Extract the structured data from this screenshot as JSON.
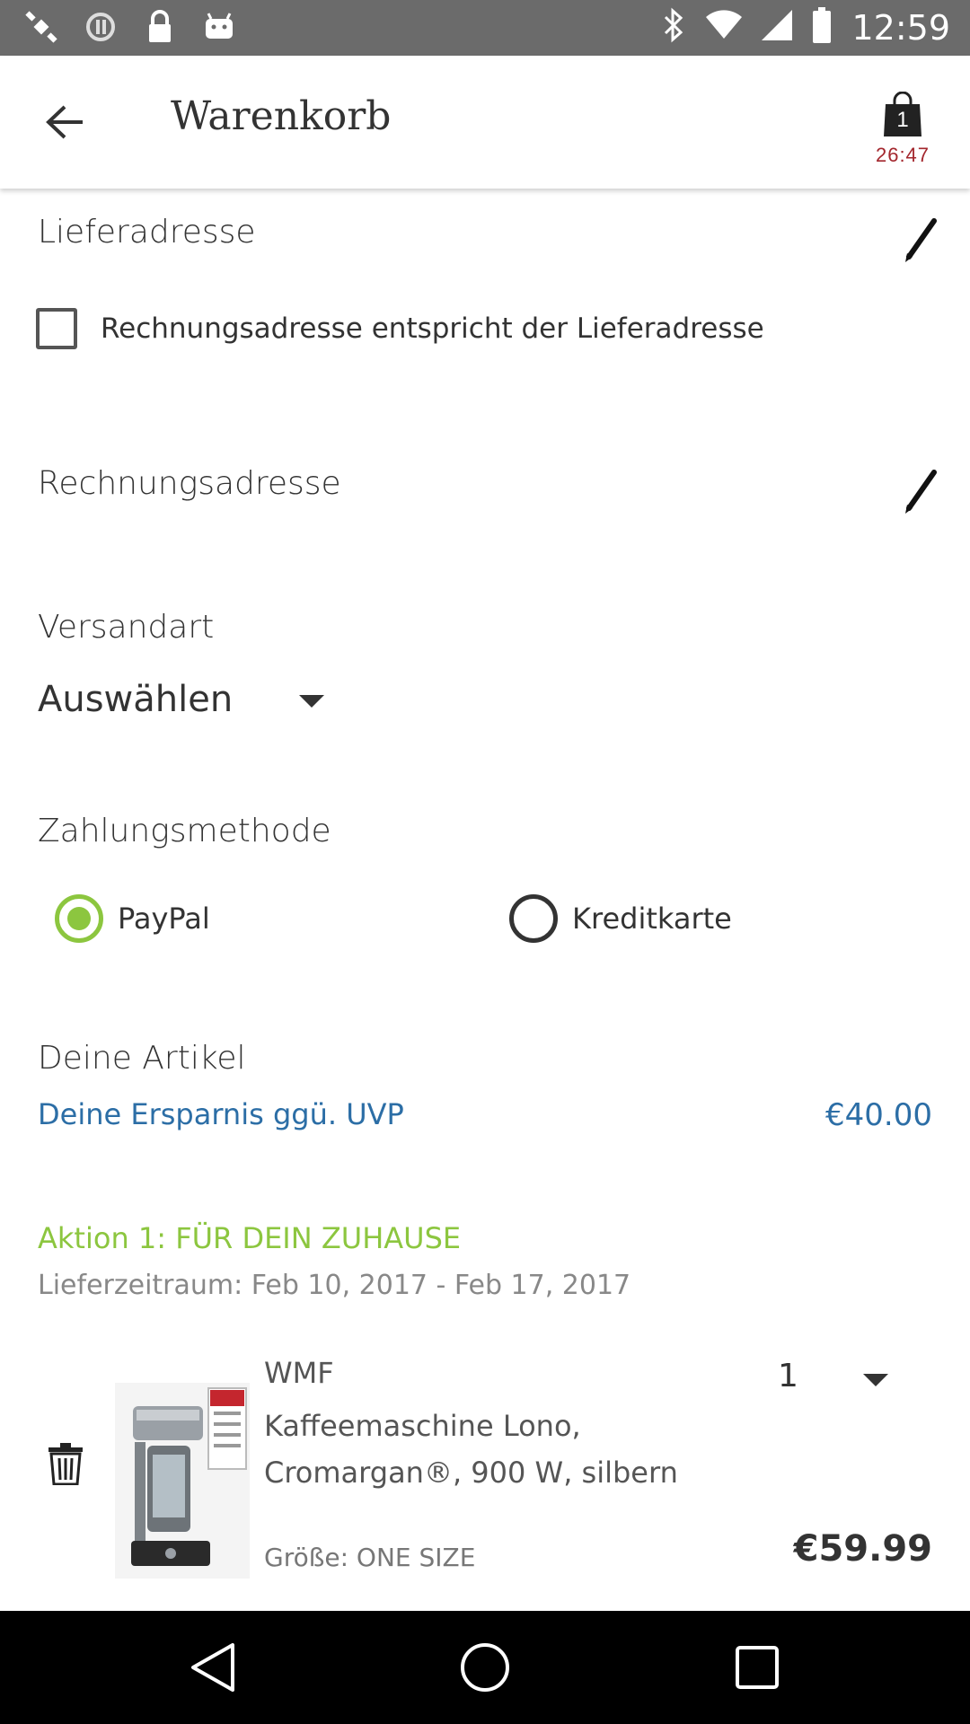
{
  "status_bar": {
    "time": "12:59",
    "left_icons": [
      "satellite-icon",
      "sync-icon",
      "lock-icon",
      "android-icon"
    ],
    "right_icons": [
      "bluetooth-icon",
      "wifi-icon",
      "signal-icon",
      "battery-icon"
    ]
  },
  "header": {
    "title": "Warenkorb",
    "cart_count": "1",
    "cart_timer": "26:47"
  },
  "shipping_address": {
    "label": "Lieferadresse"
  },
  "billing_checkbox": {
    "label": "Rechnungsadresse entspricht der Lieferadresse",
    "checked": false
  },
  "billing_address": {
    "label": "Rechnungsadresse"
  },
  "shipping_method": {
    "label": "Versandart",
    "value": "Auswählen"
  },
  "payment": {
    "label": "Zahlungsmethode",
    "options": [
      {
        "label": "PayPal",
        "selected": true
      },
      {
        "label": "Kreditkarte",
        "selected": false
      }
    ],
    "selected_color": "#8cc63f"
  },
  "articles": {
    "label": "Deine Artikel",
    "savings_label": "Deine Ersparnis ggü. UVP",
    "savings_amount": "€40.00",
    "savings_color": "#2c6ea6"
  },
  "promo": {
    "title": "Aktion 1: FÜR DEIN ZUHAUSE",
    "delivery": "Lieferzeitraum: Feb 10, 2017 - Feb 17, 2017",
    "accent_color": "#8cc63f"
  },
  "item": {
    "brand": "WMF",
    "name": "Kaffeemaschine Lono, Cromargan®, 900 W, silbern",
    "quantity": "1",
    "size": "Größe: ONE SIZE",
    "price": "€59.99"
  },
  "nav": {
    "icons": [
      "back-nav-icon",
      "home-nav-icon",
      "recents-nav-icon"
    ]
  }
}
